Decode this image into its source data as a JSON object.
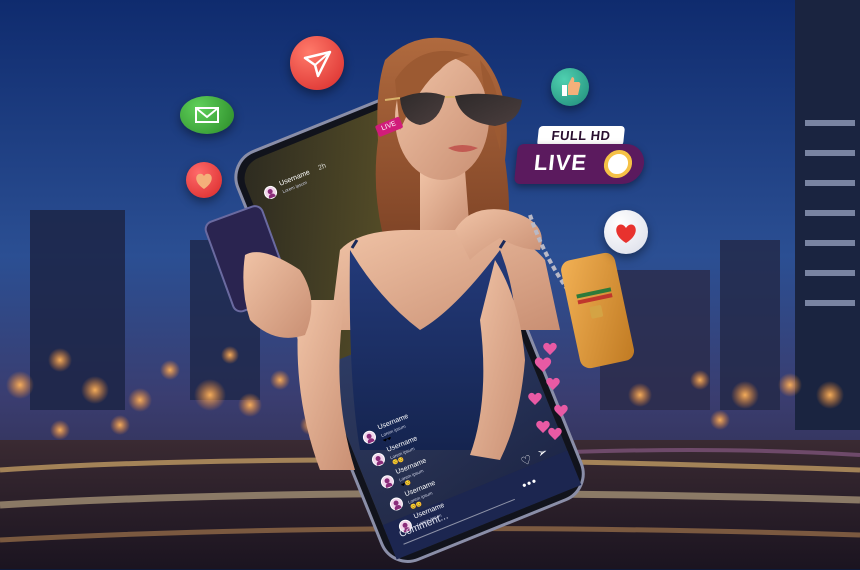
{
  "phone_header": {
    "live_badge": "LIVE",
    "username": "Username",
    "timestamp": "2h",
    "subtitle": "Lorem ipsum"
  },
  "fullhd_badge": {
    "top_text": "FULL HD",
    "main_text": "LIVE"
  },
  "comments": [
    {
      "username": "Username",
      "text": "Lorem ipsum",
      "emoji": "❤❤"
    },
    {
      "username": "Username",
      "text": "Lorem ipsum",
      "emoji": "😊😊"
    },
    {
      "username": "Username",
      "text": "Lorem ipsum",
      "emoji": "❤😊"
    },
    {
      "username": "Username",
      "text": "Lorem ipsum",
      "emoji": "😊😊"
    },
    {
      "username": "Username",
      "text": "Lorem ipsum",
      "emoji": ""
    }
  ],
  "comment_input": {
    "placeholder": "Comment..."
  },
  "floating_icons": [
    "paper-plane-icon",
    "email-icon",
    "heart-icon",
    "like-icon",
    "heart-icon"
  ],
  "colors": {
    "live_badge": "#d11c7a",
    "fullhd_badge": "#5b1a5e",
    "record_ring": "#f5c146",
    "plane_bubble": "#e63a3a",
    "email_bubble": "#3aa534",
    "like_bubble": "#2aa58f"
  }
}
